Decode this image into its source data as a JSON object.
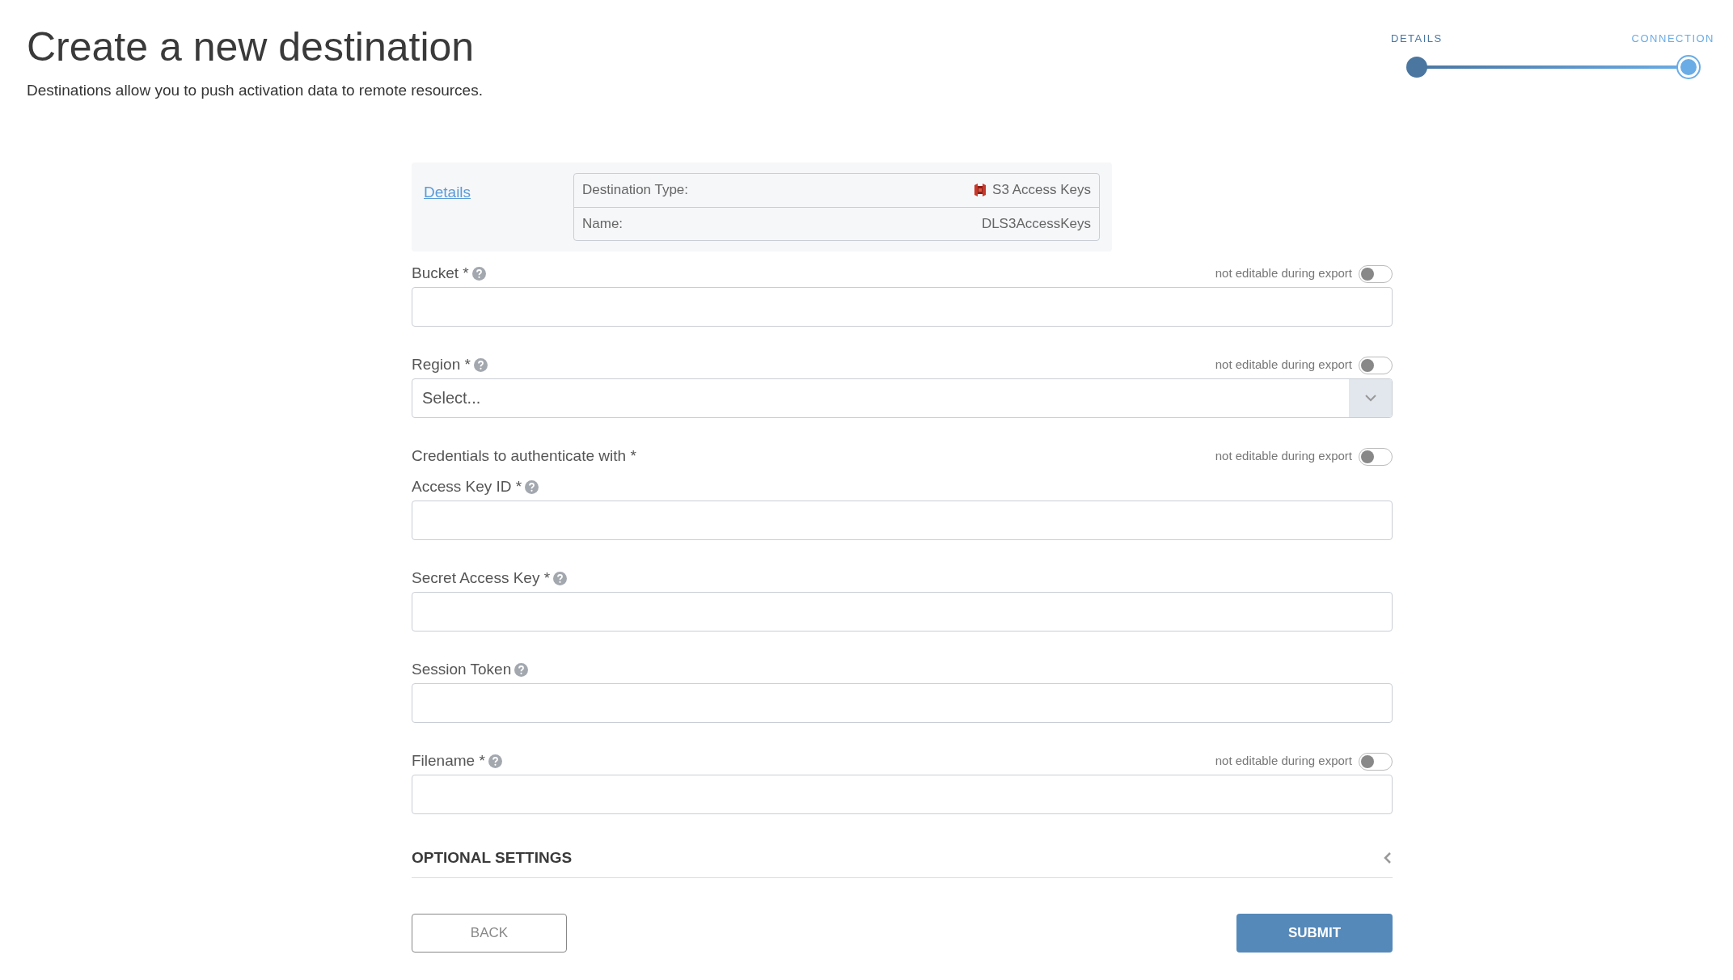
{
  "header": {
    "title": "Create a new destination",
    "subtitle": "Destinations allow you to push activation data to remote resources."
  },
  "stepper": [
    {
      "label": "DETAILS",
      "selected": false
    },
    {
      "label": "CONNECTION",
      "selected": true
    }
  ],
  "details_card": {
    "link": "Details",
    "rows": [
      {
        "label": "Destination Type:",
        "value": "S3 Access Keys",
        "icon": true
      },
      {
        "label": "Name:",
        "value": "DLS3AccessKeys",
        "icon": false
      }
    ]
  },
  "fields": [
    {
      "kind": "text",
      "label": "Bucket *",
      "help": true,
      "toggle": {
        "label": "not editable during export",
        "on": false
      }
    },
    {
      "kind": "select",
      "label": "Region *",
      "help": true,
      "placeholder": "Select...",
      "toggle": {
        "label": "not editable during export",
        "on": false
      }
    },
    {
      "kind": "heading",
      "label": "Credentials to authenticate with *",
      "help": false,
      "toggle": {
        "label": "not editable during export",
        "on": false
      }
    },
    {
      "kind": "text",
      "label": "Access Key ID *",
      "help": true
    },
    {
      "kind": "text",
      "label": "Secret Access Key *",
      "help": true
    },
    {
      "kind": "text",
      "label": "Session Token",
      "help": true
    },
    {
      "kind": "text",
      "label": "Filename *",
      "help": true,
      "toggle": {
        "label": "not editable during export",
        "on": false
      }
    }
  ],
  "optional_settings": {
    "label": "OPTIONAL SETTINGS",
    "expanded": false
  },
  "buttons": {
    "back": "BACK",
    "submit": "SUBMIT"
  }
}
